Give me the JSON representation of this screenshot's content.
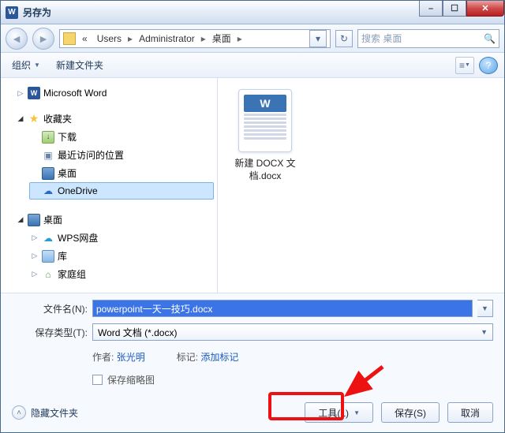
{
  "window": {
    "title": "另存为"
  },
  "nav": {
    "segments": [
      "Users",
      "Administrator",
      "桌面"
    ],
    "search_placeholder": "搜索 桌面"
  },
  "toolbar": {
    "organize": "组织",
    "new_folder": "新建文件夹"
  },
  "sidebar": {
    "word": "Microsoft Word",
    "fav": "收藏夹",
    "fav_items": {
      "dl": "下载",
      "recent": "最近访问的位置",
      "desktop": "桌面",
      "onedrive": "OneDrive"
    },
    "desk": "桌面",
    "desk_items": {
      "wps": "WPS网盘",
      "lib": "库",
      "home": "家庭组"
    }
  },
  "content": {
    "file1": "新建 DOCX 文档.docx",
    "thumb_letter": "W"
  },
  "form": {
    "filename_label": "文件名(N):",
    "filename_value": "powerpoint一天一技巧.docx",
    "type_label": "保存类型(T):",
    "type_value": "Word 文档 (*.docx)",
    "author_label": "作者:",
    "author_value": "张光明",
    "tag_label": "标记:",
    "tag_value": "添加标记",
    "thumb_check": "保存缩略图"
  },
  "footer": {
    "hidefolders": "隐藏文件夹",
    "tools": "工具(L)",
    "save": "保存(S)",
    "cancel": "取消"
  }
}
